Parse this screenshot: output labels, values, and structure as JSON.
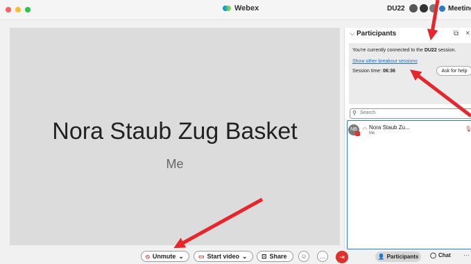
{
  "window": {
    "app_title": "Webex",
    "session_code": "DU22",
    "meeting_info": "Meeting Info",
    "colors": {
      "close": "#ff5f57",
      "minimize": "#febc2e",
      "zoom": "#28c840",
      "accent": "#2d7be0",
      "danger": "#e0302b",
      "annotation": "#e8252a"
    }
  },
  "stage": {
    "name": "Nora Staub Zug Basket",
    "subtitle": "Me"
  },
  "participants_panel": {
    "title": "Participants",
    "info_prefix": "You're currently connected to the ",
    "info_session": "DU22",
    "info_suffix": " session.",
    "breakout_link": "Show other breakout sessions",
    "session_time_label": "Session time: ",
    "session_time_value": "06:36",
    "help_button": "Ask for help",
    "search_placeholder": "Search",
    "participants": [
      {
        "initials": "NB",
        "name": "Nora Staub Zu...",
        "sub": "Me"
      }
    ]
  },
  "toolbar": {
    "unmute_label": "Unmute",
    "start_video_label": "Start video",
    "share_label": "Share",
    "participants_label": "Participants",
    "chat_label": "Chat"
  },
  "icons": [
    "mic-muted-icon",
    "video-off-icon",
    "share-icon",
    "reactions-icon",
    "more-icon",
    "leave-icon",
    "search-icon",
    "popout-icon",
    "close-icon",
    "chevron-down-icon"
  ]
}
